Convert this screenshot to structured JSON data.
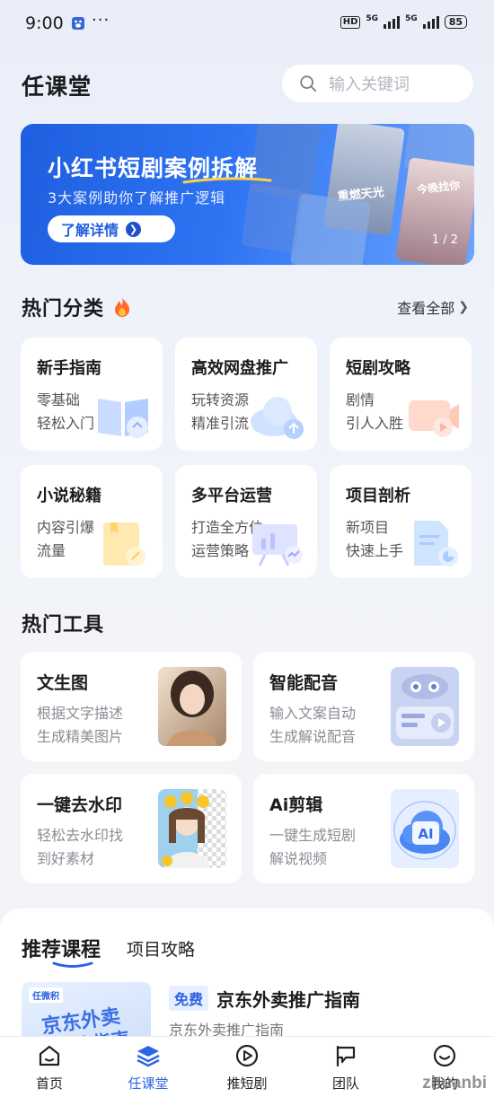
{
  "status_bar": {
    "time": "9:00",
    "more": "···",
    "hd": "HD",
    "net1": "5G",
    "net2": "5G",
    "battery": "85"
  },
  "header": {
    "title": "任课堂",
    "search_placeholder": "输入关键词"
  },
  "banner": {
    "title": "小红书短剧案例拆解",
    "subtitle": "3大案例助你了解推广逻辑",
    "button": "了解详情",
    "poster_texts": [
      "重燃天光",
      "今晚找你"
    ],
    "pager": "1 / 2"
  },
  "categories": {
    "title": "热门分类",
    "see_all": "查看全部",
    "items": [
      {
        "title": "新手指南",
        "line1": "零基础",
        "line2": "轻松入门"
      },
      {
        "title": "高效网盘推广",
        "line1": "玩转资源",
        "line2": "精准引流"
      },
      {
        "title": "短剧攻略",
        "line1": "剧情",
        "line2": "引人入胜"
      },
      {
        "title": "小说秘籍",
        "line1": "内容引爆",
        "line2": "流量"
      },
      {
        "title": "多平台运营",
        "line1": "打造全方位",
        "line2": "运营策略"
      },
      {
        "title": "项目剖析",
        "line1": "新项目",
        "line2": "快速上手"
      }
    ]
  },
  "tools": {
    "title": "热门工具",
    "items": [
      {
        "title": "文生图",
        "line1": "根据文字描述",
        "line2": "生成精美图片"
      },
      {
        "title": "智能配音",
        "line1": "输入文案自动",
        "line2": "生成解说配音"
      },
      {
        "title": "一键去水印",
        "line1": "轻松去水印找",
        "line2": "到好素材"
      },
      {
        "title": "Ai剪辑",
        "line1": "一键生成短剧",
        "line2": "解说视频"
      }
    ],
    "ai_badge": "AI"
  },
  "recommend": {
    "tab_active": "推荐课程",
    "tab_other": "项目攻略",
    "course": {
      "tag": "免费",
      "title": "京东外卖推广指南",
      "subtitle": "京东外卖推广指南",
      "thumb_brand": "任微积",
      "thumb_text": "京东外卖",
      "thumb_text2": "推广指南"
    }
  },
  "nav": {
    "items": [
      {
        "label": "首页"
      },
      {
        "label": "任课堂"
      },
      {
        "label": "推短剧"
      },
      {
        "label": "团队"
      },
      {
        "label": "我的"
      }
    ]
  },
  "watermark": "zhuanbi",
  "colors": {
    "accent": "#2c64e6",
    "banner": "#2d73f2"
  }
}
